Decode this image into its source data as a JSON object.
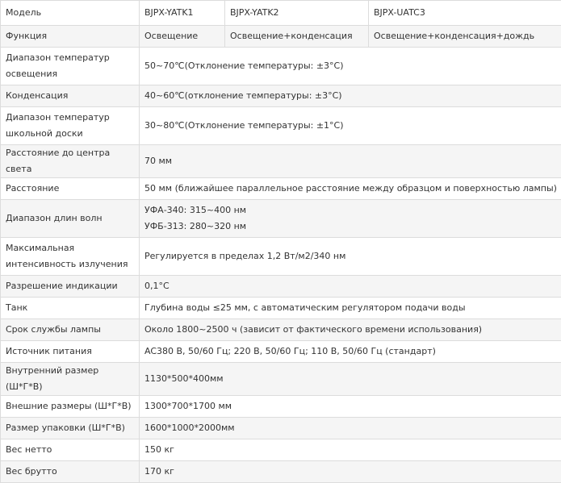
{
  "rows": [
    {
      "label": "Модель",
      "cells": [
        "BJPX-YATK1",
        "BJPX-YATK2",
        "BJPX-UATC3"
      ]
    },
    {
      "label": "Функция",
      "cells": [
        "Освещение",
        "Освещение+конденсация",
        "Освещение+конденсация+дождь"
      ]
    },
    {
      "label": "Диапазон температур освещения",
      "value": "50~70℃(Отклонение температуры: ±3°C)"
    },
    {
      "label": "Конденсация",
      "value": "40~60℃(отклонение температуры: ±3°C)"
    },
    {
      "label": "Диапазон температур школьной доски",
      "value": "30~80℃(Отклонение температуры: ±1°C)"
    },
    {
      "label": "Расстояние до центра света",
      "value": "70 мм"
    },
    {
      "label": "Расстояние",
      "value": "50 мм (ближайшее параллельное расстояние между образцом и поверхностью лампы)"
    },
    {
      "label": "Диапазон длин волн",
      "lines": [
        "УФА-340: 315~400 нм",
        "УФБ-313: 280~320 нм"
      ]
    },
    {
      "label": "Максимальная интенсивность излучения",
      "value": "Регулируется в пределах 1,2 Вт/м2/340 нм"
    },
    {
      "label": "Разрешение индикации",
      "value": "0,1°C"
    },
    {
      "label": "Танк",
      "value": "Глубина воды ≤25 мм, с автоматическим регулятором подачи воды"
    },
    {
      "label": "Срок службы лампы",
      "value": "Около 1800~2500 ч (зависит от фактического времени использования)"
    },
    {
      "label": "Источник питания",
      "value": "AC380 В, 50/60 Гц; 220 В, 50/60 Гц; 110 В, 50/60 Гц (стандарт)"
    },
    {
      "label": "Внутренний размер (Ш*Г*В)",
      "value": "1130*500*400мм"
    },
    {
      "label": "Внешние размеры (Ш*Г*В)",
      "value": "1300*700*1700 мм"
    },
    {
      "label": "Размер упаковки (Ш*Г*В)",
      "value": "1600*1000*2000мм"
    },
    {
      "label": "Вес нетто",
      "value": "150 кг"
    },
    {
      "label": "Вес брутто",
      "value": "170 кг"
    }
  ]
}
